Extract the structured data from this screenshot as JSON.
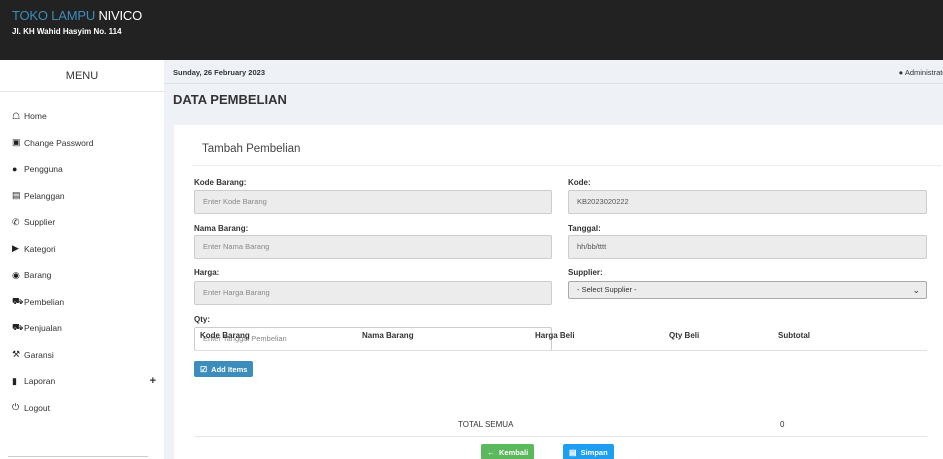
{
  "header": {
    "brand_part1": "TOKO LAMPU",
    "brand_part2": "NIVICO",
    "address": "Jl. KH Wahid Hasyim No. 114"
  },
  "sidebar": {
    "menu_title": "MENU",
    "items": [
      {
        "label": "Home",
        "icon": "home-icon"
      },
      {
        "label": "Change Password",
        "icon": "lock-icon"
      },
      {
        "label": "Pengguna",
        "icon": "user-icon"
      },
      {
        "label": "Pelanggan",
        "icon": "list-icon"
      },
      {
        "label": "Supplier",
        "icon": "phone-icon"
      },
      {
        "label": "Kategori",
        "icon": "tag-icon"
      },
      {
        "label": "Barang",
        "icon": "box-icon"
      },
      {
        "label": "Pembelian",
        "icon": "cart-icon"
      },
      {
        "label": "Penjualan",
        "icon": "cart-out-icon"
      },
      {
        "label": "Garansi",
        "icon": "wrench-icon"
      },
      {
        "label": "Laporan",
        "icon": "file-icon"
      },
      {
        "label": "Logout",
        "icon": "power-icon"
      }
    ],
    "expand_symbol": "+"
  },
  "topbar": {
    "date": "Sunday, 26 February 2023",
    "user": "Administrator"
  },
  "page": {
    "title": "DATA PEMBELIAN",
    "box_title": "Tambah Pembelian"
  },
  "form": {
    "kode_barang_label": "Kode Barang:",
    "kode_barang_placeholder": "Enter Kode Barang",
    "nama_barang_label": "Nama Barang:",
    "nama_barang_placeholder": "Enter Nama Barang",
    "harga_label": "Harga:",
    "harga_placeholder": "Enter Harga Barang",
    "qty_label": "Qty:",
    "qty_placeholder": "Enter Tanggal Pembelian",
    "kode_label": "Kode:",
    "kode_value": "KB2023020222",
    "tanggal_label": "Tanggal:",
    "tanggal_value": "hh/bb/tttt",
    "supplier_label": "Supplier:",
    "supplier_selected": "- Select Supplier -",
    "add_items_label": "Add Items"
  },
  "table": {
    "headers": [
      "Kode Barang",
      "Nama Barang",
      "Harga Beli",
      "Qty Beli",
      "Subtotal"
    ],
    "total_label": "TOTAL SEMUA",
    "total_value": "0"
  },
  "actions": {
    "back_label": "Kembali",
    "save_label": "Simpan"
  },
  "colors": {
    "brand_accent": "#3c8dbc",
    "topbar": "#222222",
    "btn_green": "#5cb85c",
    "btn_sky": "#1e9ef0"
  }
}
